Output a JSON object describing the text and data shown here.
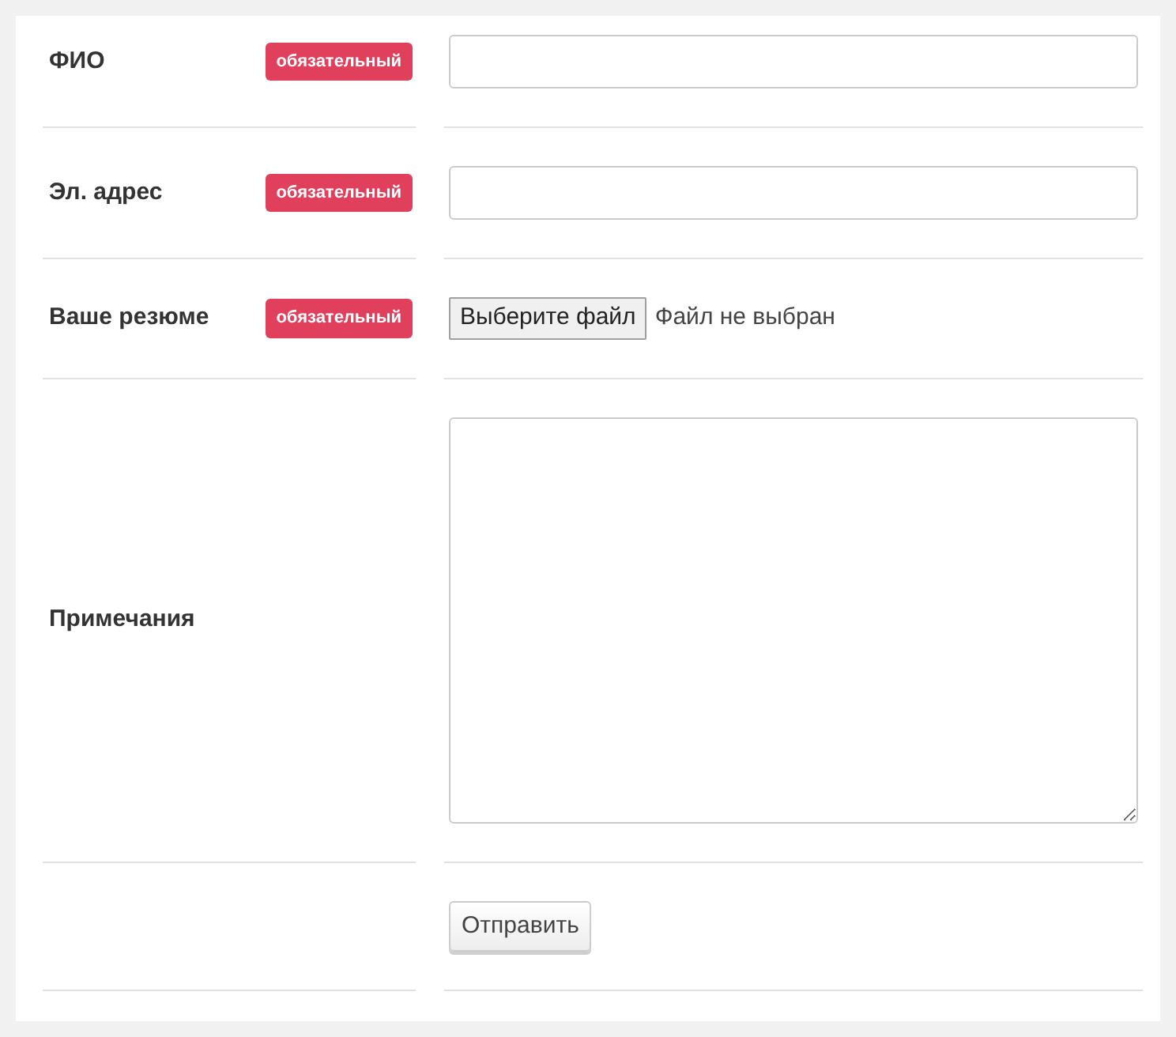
{
  "rows": [
    {
      "label": "ФИО",
      "required": true,
      "badge": "обязательный",
      "field": {
        "kind": "text"
      }
    },
    {
      "label": "Эл. адрес",
      "required": true,
      "badge": "обязательный",
      "field": {
        "kind": "text"
      }
    },
    {
      "label": "Ваше резюме",
      "required": true,
      "badge": "обязательный",
      "field": {
        "kind": "file",
        "button": "Выберите файл",
        "status": "Файл не выбран"
      }
    },
    {
      "label": "Примечания",
      "required": false,
      "field": {
        "kind": "textarea"
      }
    },
    {
      "field": {
        "kind": "submit",
        "button": "Отправить"
      }
    }
  ]
}
